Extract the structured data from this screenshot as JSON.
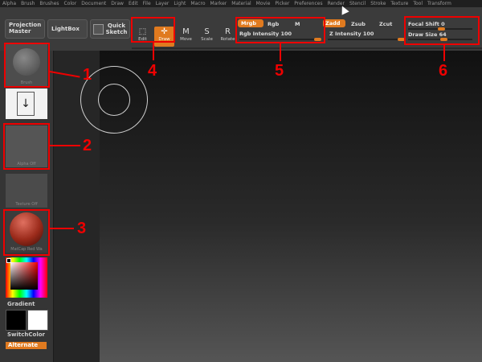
{
  "menu": [
    "Alpha",
    "Brush",
    "Brushes",
    "Color",
    "Document",
    "Draw",
    "Edit",
    "File",
    "Layer",
    "Light",
    "Macro",
    "Marker",
    "Material",
    "Movie",
    "Picker",
    "Preferences",
    "Render",
    "Stencil",
    "Stroke",
    "Texture",
    "Tool",
    "Transform"
  ],
  "toolbar": {
    "projection_master": "Projection Master",
    "lightbox": "LightBox",
    "quick_sketch": "Quick Sketch",
    "tools": [
      {
        "label": "Edit",
        "icon": "edit-icon",
        "active": false
      },
      {
        "label": "Draw",
        "icon": "draw-icon",
        "active": true
      },
      {
        "label": "Move",
        "icon": "move-icon",
        "active": false
      },
      {
        "label": "Scale",
        "icon": "scale-icon",
        "active": false
      },
      {
        "label": "Rotate",
        "icon": "rotate-icon",
        "active": false
      }
    ],
    "mrgb": "Mrgb",
    "rgb": "Rgb",
    "m": "M",
    "rgb_intensity": "Rgb Intensity 100",
    "zadd": "Zadd",
    "zsub": "Zsub",
    "zcut": "Zcut",
    "z_intensity": "Z Intensity 100",
    "focal_shift": "Focal Shift 0",
    "draw_size": "Draw Size 64"
  },
  "sidebar": {
    "brush_caption": "Brush",
    "alpha_caption": "Alpha Off",
    "texture_caption": "Texture Off",
    "material_caption": "MatCap Red Wa",
    "gradient": "Gradient",
    "switch_color": "SwitchColor",
    "alternate": "Alternate"
  },
  "callouts": [
    "1",
    "2",
    "3",
    "4",
    "5",
    "6"
  ],
  "colors": {
    "accent": "#e07a1f",
    "callout": "#ee0000"
  }
}
